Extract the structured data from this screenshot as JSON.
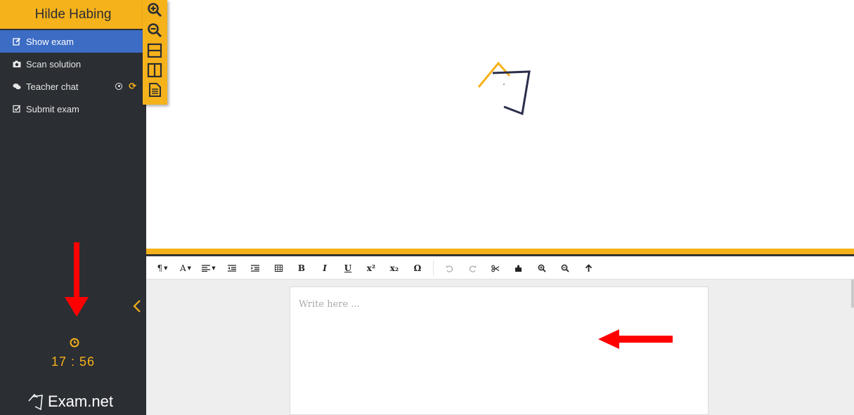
{
  "sidebar": {
    "user_name": "Hilde Habing",
    "items": [
      {
        "label": "Show exam",
        "icon": "edit-icon",
        "active": true
      },
      {
        "label": "Scan solution",
        "icon": "camera-icon",
        "active": false
      },
      {
        "label": "Teacher chat",
        "icon": "chat-bubbles-icon",
        "active": false
      },
      {
        "label": "Submit exam",
        "icon": "checkbox-icon",
        "active": false
      }
    ],
    "timer": "17 : 56",
    "brand": "Exam.net"
  },
  "zoom_toolbar": [
    "zoom-in-icon",
    "zoom-out-icon",
    "split-horizontal-icon",
    "split-vertical-icon",
    "document-icon"
  ],
  "editor": {
    "toolbar": {
      "paragraph": "¶",
      "font": "A",
      "bold": "B",
      "italic": "I",
      "underline": "U",
      "superscript": "x²",
      "subscript": "x₂",
      "special_char": "Ω"
    },
    "placeholder": "Write here ..."
  },
  "colors": {
    "accent": "#f6b21b",
    "sidebar_bg": "#2b2e33",
    "active_item": "#3c6cc4",
    "annotation": "#ff0000"
  }
}
